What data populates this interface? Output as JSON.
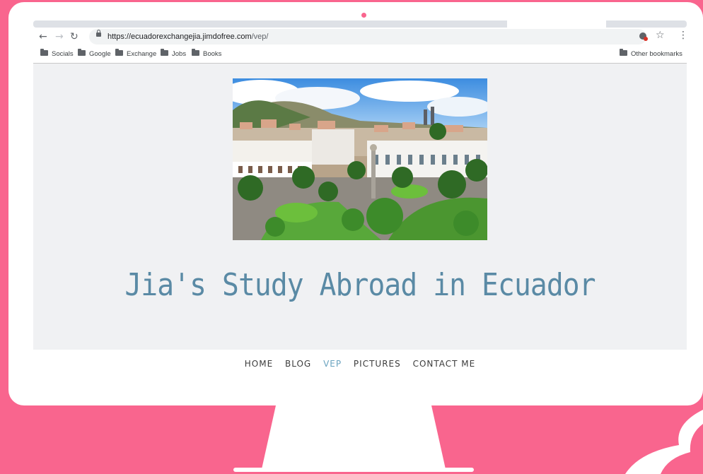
{
  "browser": {
    "url_host": "https://ecuadorexchangejia.jimdofree.com",
    "url_path": "/vep/",
    "bookmarks": [
      "Socials",
      "Google",
      "Exchange",
      "Jobs",
      "Books"
    ],
    "other_bookmarks": "Other bookmarks"
  },
  "site": {
    "title": "Jia's Study Abroad in Ecuador",
    "hero_alt": "Plaza Grande, Quito, Ecuador",
    "nav": [
      "HOME",
      "BLOG",
      "VEP",
      "PICTURES",
      "CONTACT ME"
    ],
    "active_nav": "VEP"
  },
  "colors": {
    "background": "#f9658e",
    "title": "#5a8aa5",
    "nav_active": "#6aa3bf"
  }
}
